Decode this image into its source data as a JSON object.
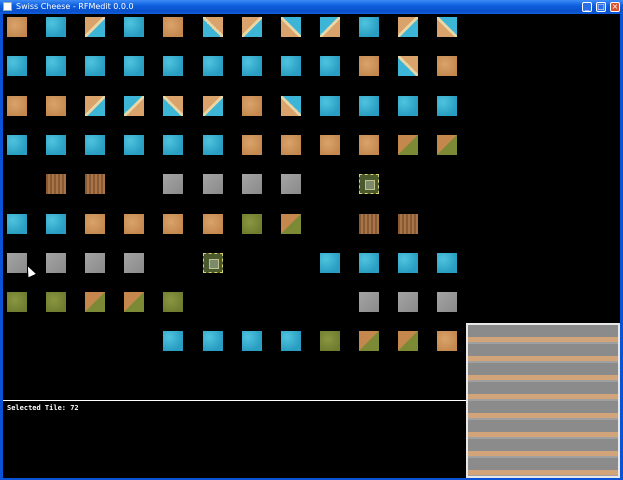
{
  "window": {
    "title": "Swiss Cheese - RFMedit 0.0.0"
  },
  "status": {
    "selected_tile_label": "Selected Tile: 72"
  },
  "tiles": [
    {
      "t": "sand"
    },
    {
      "t": "water"
    },
    {
      "t": "shore-a"
    },
    {
      "t": "water"
    },
    {
      "t": "sand"
    },
    {
      "t": "shore-b"
    },
    {
      "t": "shore-a"
    },
    {
      "t": "shore-c"
    },
    {
      "t": "shore-d"
    },
    {
      "t": "water"
    },
    {
      "t": "shore-a"
    },
    {
      "t": "shore-c"
    },
    {
      "t": "water"
    },
    {
      "t": "water"
    },
    {
      "t": "water"
    },
    {
      "t": "water"
    },
    {
      "t": "water"
    },
    {
      "t": "water"
    },
    {
      "t": "water"
    },
    {
      "t": "water"
    },
    {
      "t": "water"
    },
    {
      "t": "sand"
    },
    {
      "t": "shore-b"
    },
    {
      "t": "sand"
    },
    {
      "t": "sand"
    },
    {
      "t": "sand"
    },
    {
      "t": "shore-a"
    },
    {
      "t": "shore-d"
    },
    {
      "t": "shore-b"
    },
    {
      "t": "shore-a"
    },
    {
      "t": "sand"
    },
    {
      "t": "shore-c"
    },
    {
      "t": "water"
    },
    {
      "t": "water"
    },
    {
      "t": "water"
    },
    {
      "t": "water"
    },
    {
      "t": "water"
    },
    {
      "t": "water"
    },
    {
      "t": "water"
    },
    {
      "t": "water"
    },
    {
      "t": "water"
    },
    {
      "t": "water"
    },
    {
      "t": "sand"
    },
    {
      "t": "sand"
    },
    {
      "t": "sand"
    },
    {
      "t": "sand"
    },
    {
      "t": "sandgrass"
    },
    {
      "t": "sandgrass"
    },
    {
      "t": "none"
    },
    {
      "t": "wood"
    },
    {
      "t": "wood"
    },
    {
      "t": "none"
    },
    {
      "t": "stone"
    },
    {
      "t": "stone"
    },
    {
      "t": "stone"
    },
    {
      "t": "stone"
    },
    {
      "t": "none"
    },
    {
      "t": "dashed"
    },
    {
      "t": "none"
    },
    {
      "t": "none"
    },
    {
      "t": "water"
    },
    {
      "t": "water"
    },
    {
      "t": "sand"
    },
    {
      "t": "sand"
    },
    {
      "t": "sand"
    },
    {
      "t": "sand"
    },
    {
      "t": "grass"
    },
    {
      "t": "sandgrass"
    },
    {
      "t": "none"
    },
    {
      "t": "wood"
    },
    {
      "t": "wood"
    },
    {
      "t": "none"
    },
    {
      "t": "stone"
    },
    {
      "t": "stone"
    },
    {
      "t": "stone"
    },
    {
      "t": "stone"
    },
    {
      "t": "none"
    },
    {
      "t": "dashed"
    },
    {
      "t": "none"
    },
    {
      "t": "none"
    },
    {
      "t": "water"
    },
    {
      "t": "water"
    },
    {
      "t": "water"
    },
    {
      "t": "water"
    },
    {
      "t": "grass"
    },
    {
      "t": "grass"
    },
    {
      "t": "sandgrass"
    },
    {
      "t": "sandgrass"
    },
    {
      "t": "grass"
    },
    {
      "t": "none"
    },
    {
      "t": "none"
    },
    {
      "t": "none"
    },
    {
      "t": "none"
    },
    {
      "t": "stone"
    },
    {
      "t": "stone"
    },
    {
      "t": "stone"
    },
    {
      "t": "none"
    },
    {
      "t": "none"
    },
    {
      "t": "none"
    },
    {
      "t": "none"
    },
    {
      "t": "water"
    },
    {
      "t": "water"
    },
    {
      "t": "water"
    },
    {
      "t": "water"
    },
    {
      "t": "grass"
    },
    {
      "t": "sandgrass"
    },
    {
      "t": "sandgrass"
    },
    {
      "t": "sand"
    }
  ]
}
